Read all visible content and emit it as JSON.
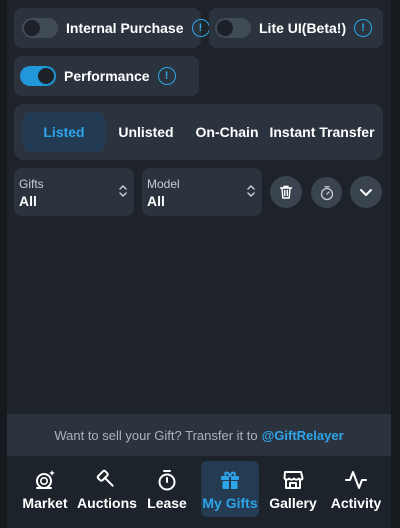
{
  "toggles": {
    "internal_purchase": {
      "label": "Internal Purchase",
      "on": false,
      "info": "!"
    },
    "lite_ui": {
      "label": "Lite UI(Beta!)",
      "on": false,
      "info": "!"
    },
    "performance": {
      "label": "Performance",
      "on": true,
      "info": "!"
    }
  },
  "tabs": [
    {
      "label": "Listed",
      "active": true
    },
    {
      "label": "Unlisted",
      "active": false
    },
    {
      "label": "On-Chain",
      "active": false
    },
    {
      "label": "Instant Transfer",
      "active": false
    }
  ],
  "filters": {
    "gifts": {
      "label": "Gifts",
      "value": "All"
    },
    "model": {
      "label": "Model",
      "value": "All"
    }
  },
  "actions": {
    "delete_icon": "trash-icon",
    "timer_icon": "stopwatch-icon",
    "expand_icon": "chevron-down-icon"
  },
  "sell_banner": {
    "text": "Want to sell your Gift? Transfer it to",
    "handle": "@GiftRelayer"
  },
  "nav": [
    {
      "label": "Market",
      "icon": "market-icon",
      "active": false
    },
    {
      "label": "Auctions",
      "icon": "gavel-icon",
      "active": false
    },
    {
      "label": "Lease",
      "icon": "stopwatch-icon",
      "active": false
    },
    {
      "label": "My Gifts",
      "icon": "gift-icon",
      "active": true
    },
    {
      "label": "Gallery",
      "icon": "store-icon",
      "active": false
    },
    {
      "label": "Activity",
      "icon": "activity-icon",
      "active": false
    }
  ],
  "colors": {
    "accent": "#2ea4e9",
    "background": "#1e2329",
    "panel": "#2b343e",
    "active_tab_bg": "#223a52"
  }
}
